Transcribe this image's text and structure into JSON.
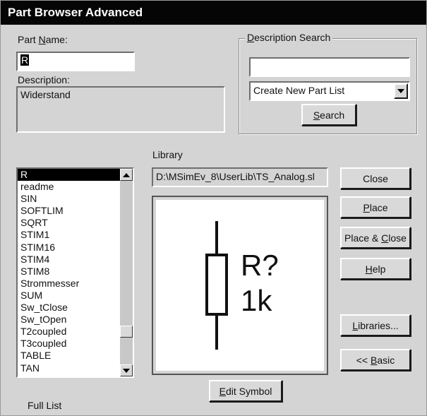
{
  "window": {
    "title": "Part Browser Advanced"
  },
  "part_name": {
    "label_pre": "Part ",
    "label_u": "N",
    "label_post": "ame:",
    "value": "R"
  },
  "description": {
    "label": "Description:",
    "value": "Widerstand"
  },
  "description_search": {
    "label_u": "D",
    "label_post": "escription Search",
    "input_value": "",
    "dropdown_value": "Create New Part List",
    "search_pre": "",
    "search_u": "S",
    "search_post": "earch"
  },
  "library": {
    "label": "Library",
    "path": "D:\\MSimEv_8\\UserLib\\TS_Analog.sl"
  },
  "parts_list": {
    "items": [
      "R",
      "readme",
      "SIN",
      "SOFTLIM",
      "SQRT",
      "STIM1",
      "STIM16",
      "STIM4",
      "STIM8",
      "Strommesser",
      "SUM",
      "Sw_tClose",
      "Sw_tOpen",
      "T2coupled",
      "T3coupled",
      "TABLE",
      "TAN"
    ],
    "selected": "R",
    "footer": "Full List"
  },
  "symbol_preview": {
    "ref": "R?",
    "value": "1k"
  },
  "buttons": {
    "close": "Close",
    "place_u": "P",
    "place_post": "lace",
    "place_close_pre": "Place & ",
    "place_close_u": "C",
    "place_close_post": "lose",
    "help_u": "H",
    "help_post": "elp",
    "libraries_u": "L",
    "libraries_post": "ibraries...",
    "basic_pre": "<< ",
    "basic_u": "B",
    "basic_post": "asic",
    "edit_symbol_u": "E",
    "edit_symbol_post": "dit Symbol"
  },
  "icons": {
    "scroll_up": "arrow-up-icon",
    "scroll_down": "arrow-down-icon",
    "dropdown": "chevron-down-icon"
  }
}
